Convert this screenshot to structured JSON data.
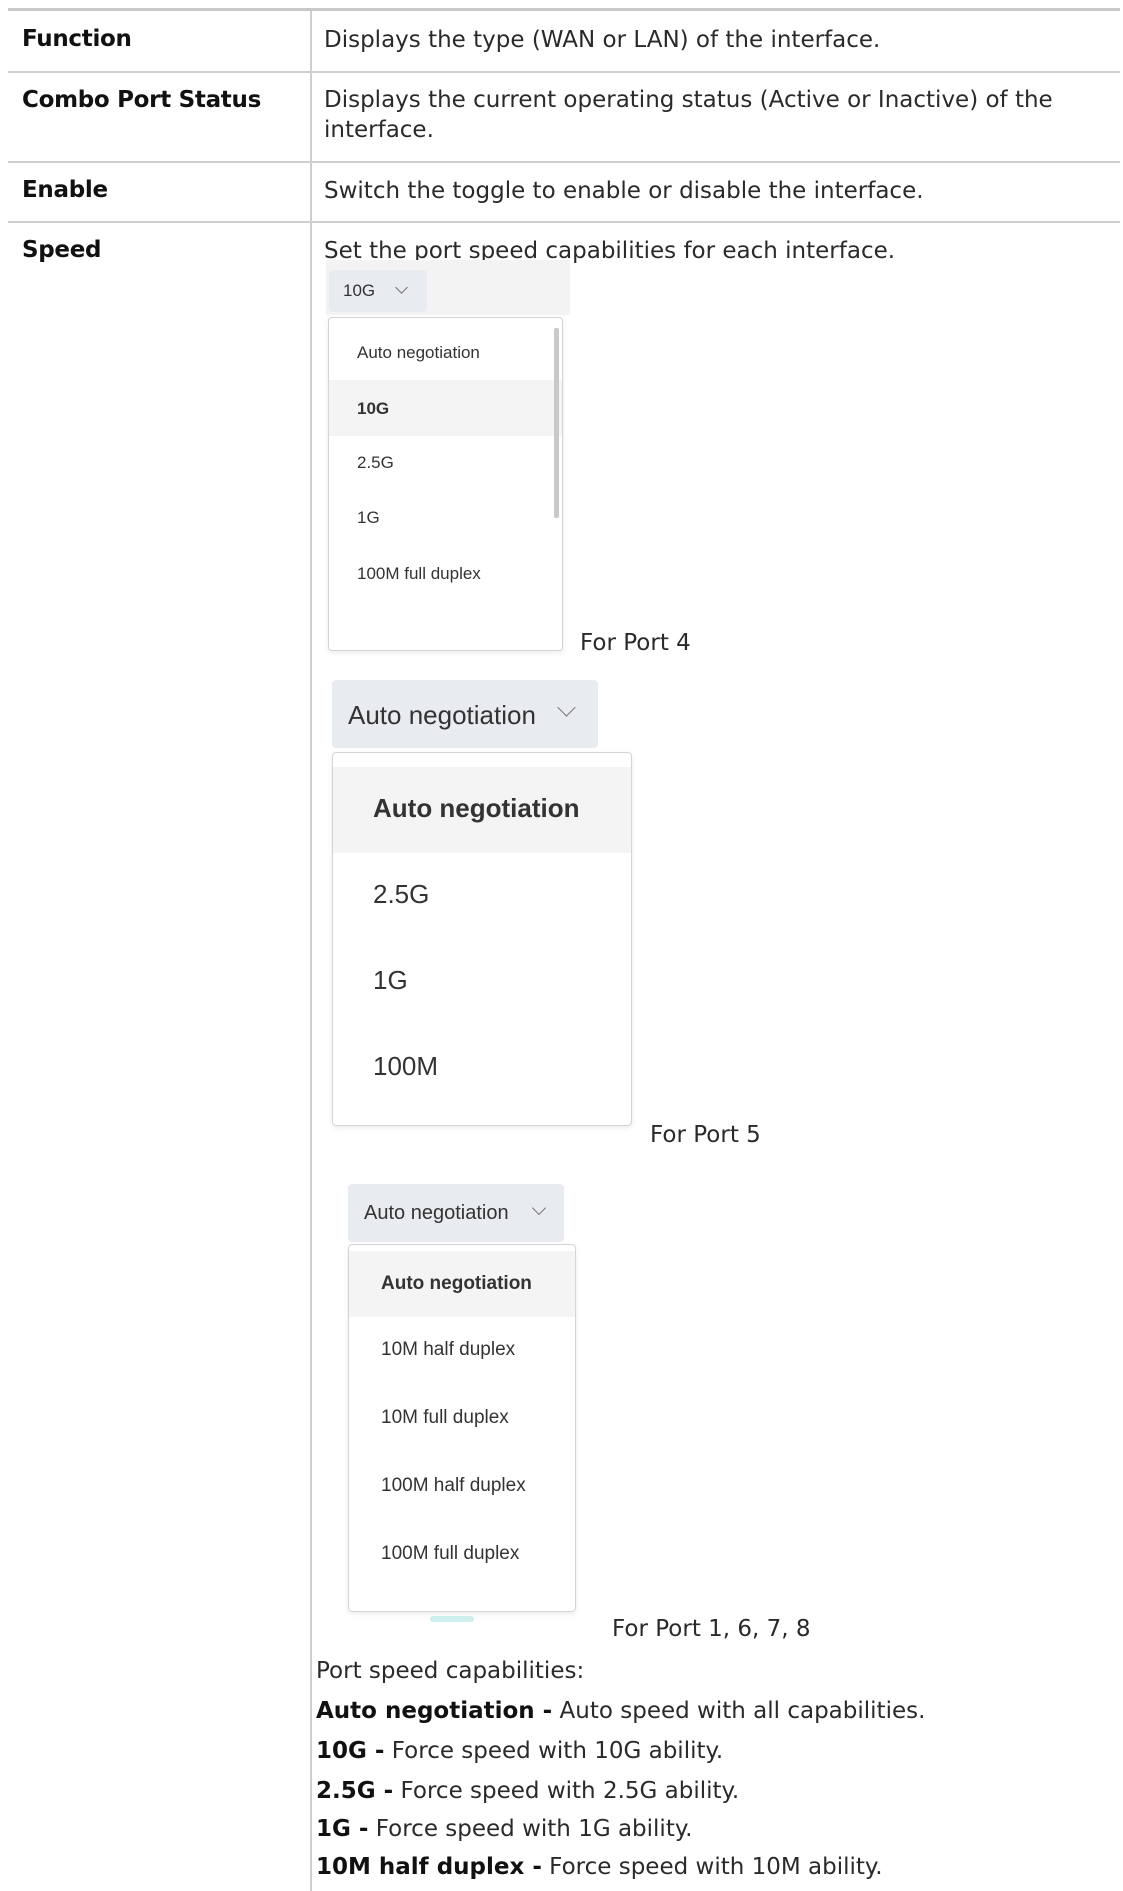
{
  "rows": [
    {
      "term": "Function",
      "desc": "Displays the type (WAN or LAN) of the interface."
    },
    {
      "term": "Combo Port Status",
      "desc_line1": "Displays the current operating status (Active or Inactive) of the",
      "desc_line2": "interface."
    },
    {
      "term": "Enable",
      "desc": "Switch the toggle to enable or disable the interface."
    },
    {
      "term": "Speed",
      "desc": "Set the port speed capabilities for each interface."
    }
  ],
  "port4": {
    "selected": "10G",
    "options": [
      "Auto negotiation",
      "10G",
      "2.5G",
      "1G",
      "100M full duplex"
    ],
    "caption": "For Port 4"
  },
  "port5": {
    "selected": "Auto negotiation",
    "options": [
      "Auto negotiation",
      "2.5G",
      "1G",
      "100M"
    ],
    "caption": "For Port 5"
  },
  "port1678": {
    "selected": "Auto negotiation",
    "options": [
      "Auto negotiation",
      "10M half duplex",
      "10M full duplex",
      "100M half duplex",
      "100M full duplex"
    ],
    "caption": "For Port 1, 6, 7, 8"
  },
  "capabilities": {
    "heading": "Port speed capabilities:",
    "items": [
      {
        "term": "Auto negotiation -",
        "text": " Auto speed with all capabilities."
      },
      {
        "term": "10G -",
        "text": " Force speed with 10G ability."
      },
      {
        "term": "2.5G -",
        "text": " Force speed with 2.5G ability."
      },
      {
        "term": "1G -",
        "text": " Force speed with 1G ability."
      },
      {
        "term": "10M half duplex -",
        "text": " Force speed with 10M ability."
      }
    ]
  }
}
